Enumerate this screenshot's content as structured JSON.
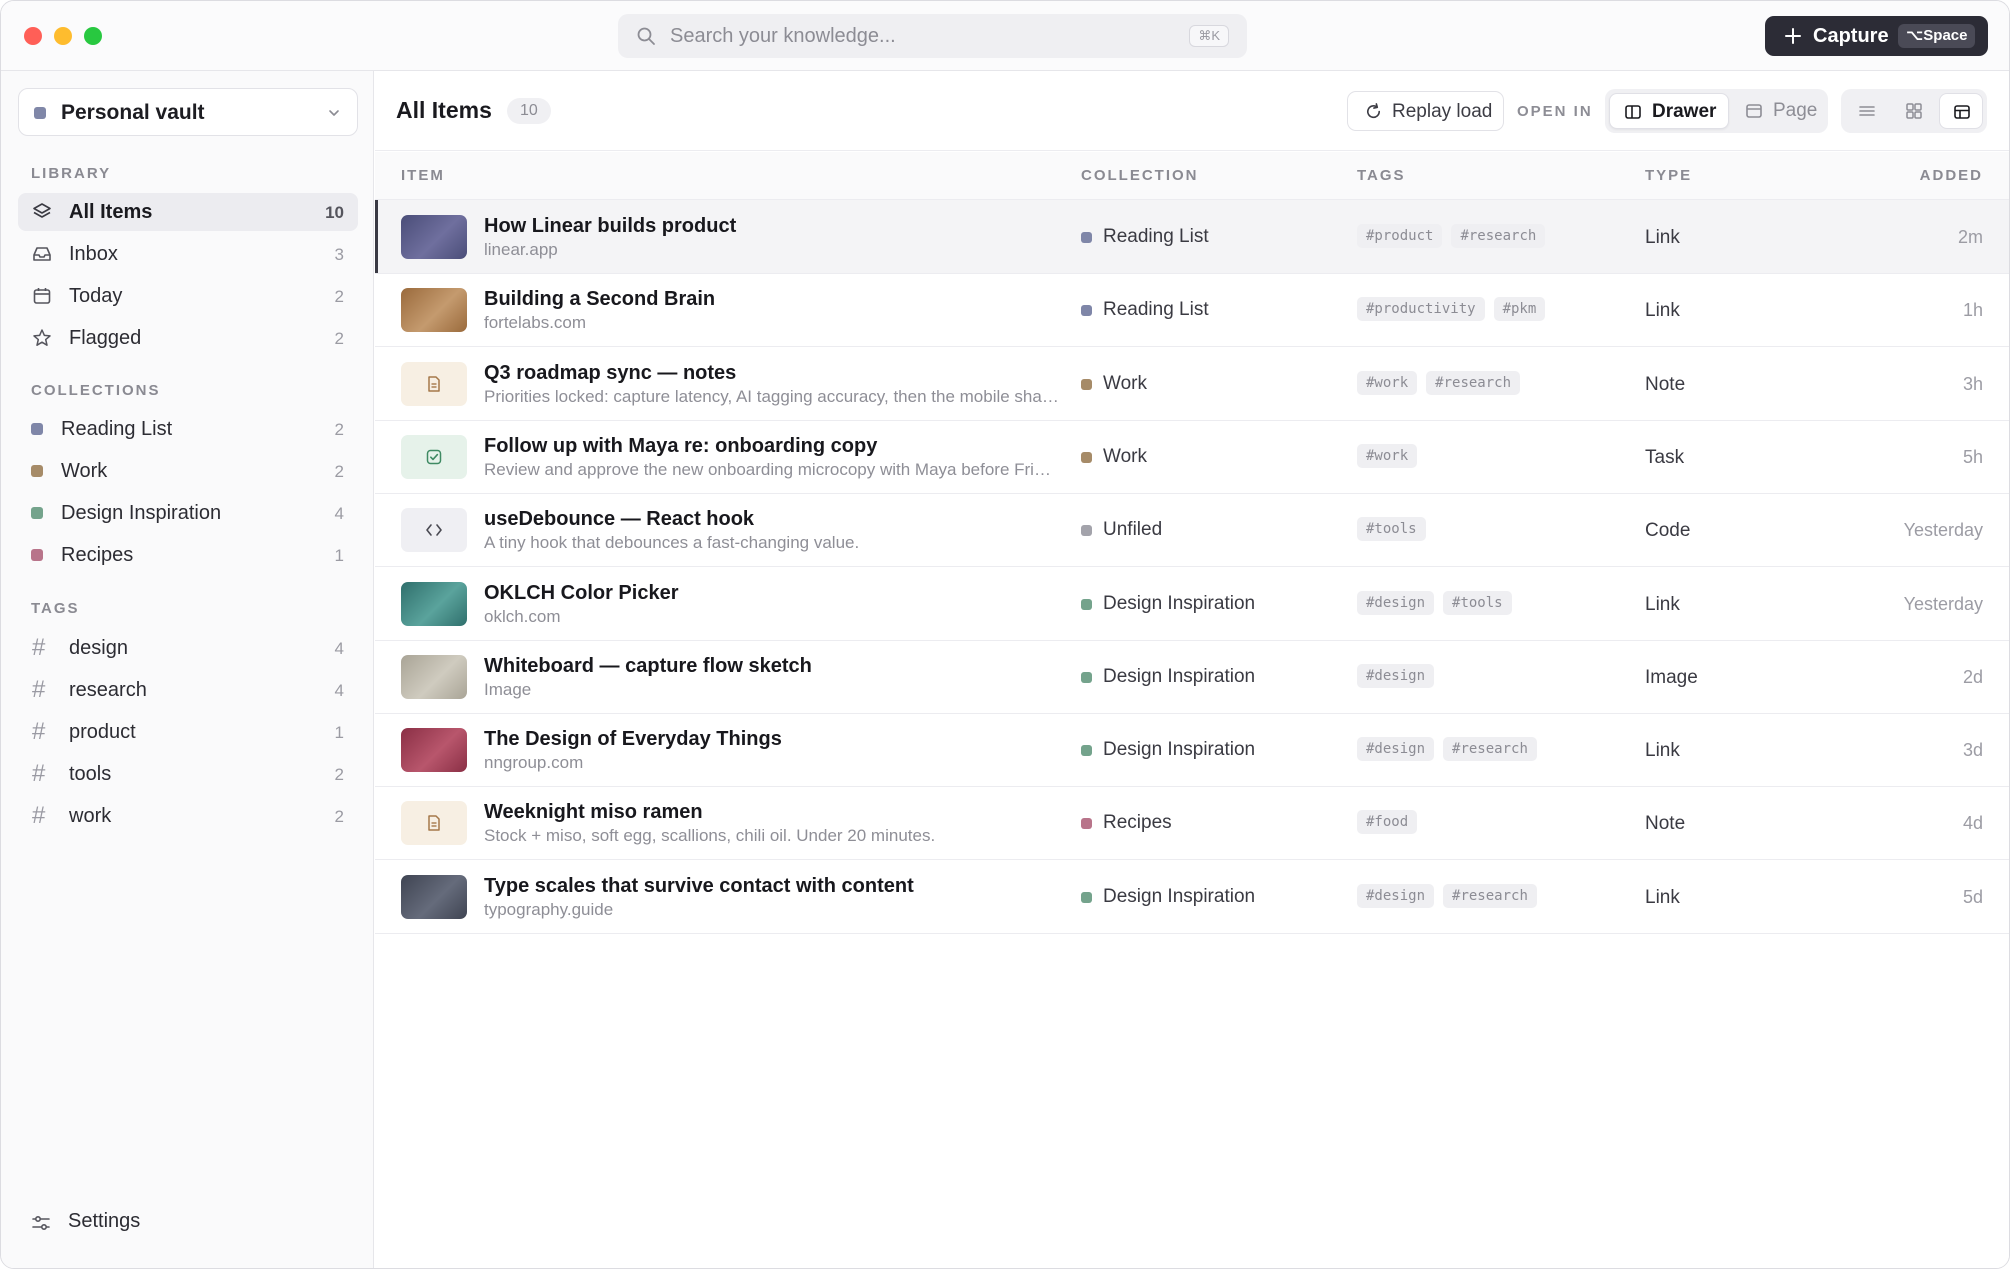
{
  "search": {
    "placeholder": "Search your knowledge...",
    "shortcut": "⌘K"
  },
  "capture": {
    "label": "Capture",
    "shortcut": "⌥Space"
  },
  "sidebar": {
    "vault": "Personal vault",
    "library_label": "LIBRARY",
    "library": [
      {
        "label": "All Items",
        "count": "10",
        "icon": "layers-icon"
      },
      {
        "label": "Inbox",
        "count": "3",
        "icon": "inbox-icon"
      },
      {
        "label": "Today",
        "count": "2",
        "icon": "calendar-icon"
      },
      {
        "label": "Flagged",
        "count": "2",
        "icon": "star-icon"
      }
    ],
    "collections_label": "COLLECTIONS",
    "collections": [
      {
        "label": "Reading List",
        "count": "2",
        "color": "#7f86a8"
      },
      {
        "label": "Work",
        "count": "2",
        "color": "#a68b68"
      },
      {
        "label": "Design Inspiration",
        "count": "4",
        "color": "#74a38c"
      },
      {
        "label": "Recipes",
        "count": "1",
        "color": "#b8748a"
      }
    ],
    "tags_label": "TAGS",
    "tags": [
      {
        "label": "design",
        "count": "4"
      },
      {
        "label": "research",
        "count": "4"
      },
      {
        "label": "product",
        "count": "1"
      },
      {
        "label": "tools",
        "count": "2"
      },
      {
        "label": "work",
        "count": "2"
      }
    ],
    "settings": "Settings"
  },
  "main": {
    "title": "All Items",
    "count": "10",
    "replay": "Replay load",
    "open_in": "OPEN IN",
    "open_options": [
      "Drawer",
      "Page"
    ],
    "columns": [
      "ITEM",
      "COLLECTION",
      "TAGS",
      "TYPE",
      "ADDED"
    ]
  },
  "colors": {
    "accent": "#2c2c36",
    "unfiled": "#a3a3ab"
  },
  "items": [
    {
      "title": "How Linear builds product",
      "sub": "linear.app",
      "collection": "Reading List",
      "coll_color": "#7f86a8",
      "tags": [
        "#product",
        "#research"
      ],
      "type": "Link",
      "added": "2m",
      "thumb": "#4a4d78",
      "thumb2": "#6f6f9e"
    },
    {
      "title": "Building a Second Brain",
      "sub": "fortelabs.com",
      "collection": "Reading List",
      "coll_color": "#7f86a8",
      "tags": [
        "#productivity",
        "#pkm"
      ],
      "type": "Link",
      "added": "1h",
      "thumb": "#9a6a3c",
      "thumb2": "#c49a6e"
    },
    {
      "title": "Q3 roadmap sync — notes",
      "sub": "Priorities locked: capture latency, AI tagging accuracy, then the mobile share sheet.",
      "collection": "Work",
      "coll_color": "#a68b68",
      "tags": [
        "#work",
        "#research"
      ],
      "type": "Note",
      "added": "3h",
      "icon": "note-icon"
    },
    {
      "title": "Follow up with Maya re: onboarding copy",
      "sub": "Review and approve the new onboarding microcopy with Maya before Friday.",
      "collection": "Work",
      "coll_color": "#a68b68",
      "tags": [
        "#work"
      ],
      "type": "Task",
      "added": "5h",
      "icon": "task-icon"
    },
    {
      "title": "useDebounce — React hook",
      "sub": "A tiny hook that debounces a fast-changing value.",
      "collection": "Unfiled",
      "coll_color": "#a3a3ab",
      "tags": [
        "#tools"
      ],
      "type": "Code",
      "added": "Yesterday",
      "icon": "code-icon"
    },
    {
      "title": "OKLCH Color Picker",
      "sub": "oklch.com",
      "collection": "Design Inspiration",
      "coll_color": "#74a38c",
      "tags": [
        "#design",
        "#tools"
      ],
      "type": "Link",
      "added": "Yesterday",
      "thumb": "#2f6f6c",
      "thumb2": "#5aa39c"
    },
    {
      "title": "Whiteboard — capture flow sketch",
      "sub": "Image",
      "collection": "Design Inspiration",
      "coll_color": "#74a38c",
      "tags": [
        "#design"
      ],
      "type": "Image",
      "added": "2d",
      "thumb": "#a9a496",
      "thumb2": "#cfcbbf"
    },
    {
      "title": "The Design of Everyday Things",
      "sub": "nngroup.com",
      "collection": "Design Inspiration",
      "coll_color": "#74a38c",
      "tags": [
        "#design",
        "#research"
      ],
      "type": "Link",
      "added": "3d",
      "thumb": "#8a2f45",
      "thumb2": "#b8566c"
    },
    {
      "title": "Weeknight miso ramen",
      "sub": "Stock + miso, soft egg, scallions, chili oil. Under 20 minutes.",
      "collection": "Recipes",
      "coll_color": "#b8748a",
      "tags": [
        "#food"
      ],
      "type": "Note",
      "added": "4d",
      "icon": "note-icon"
    },
    {
      "title": "Type scales that survive contact with content",
      "sub": "typography.guide",
      "collection": "Design Inspiration",
      "coll_color": "#74a38c",
      "tags": [
        "#design",
        "#research"
      ],
      "type": "Link",
      "added": "5d",
      "thumb": "#3f4452",
      "thumb2": "#656b7b"
    }
  ]
}
